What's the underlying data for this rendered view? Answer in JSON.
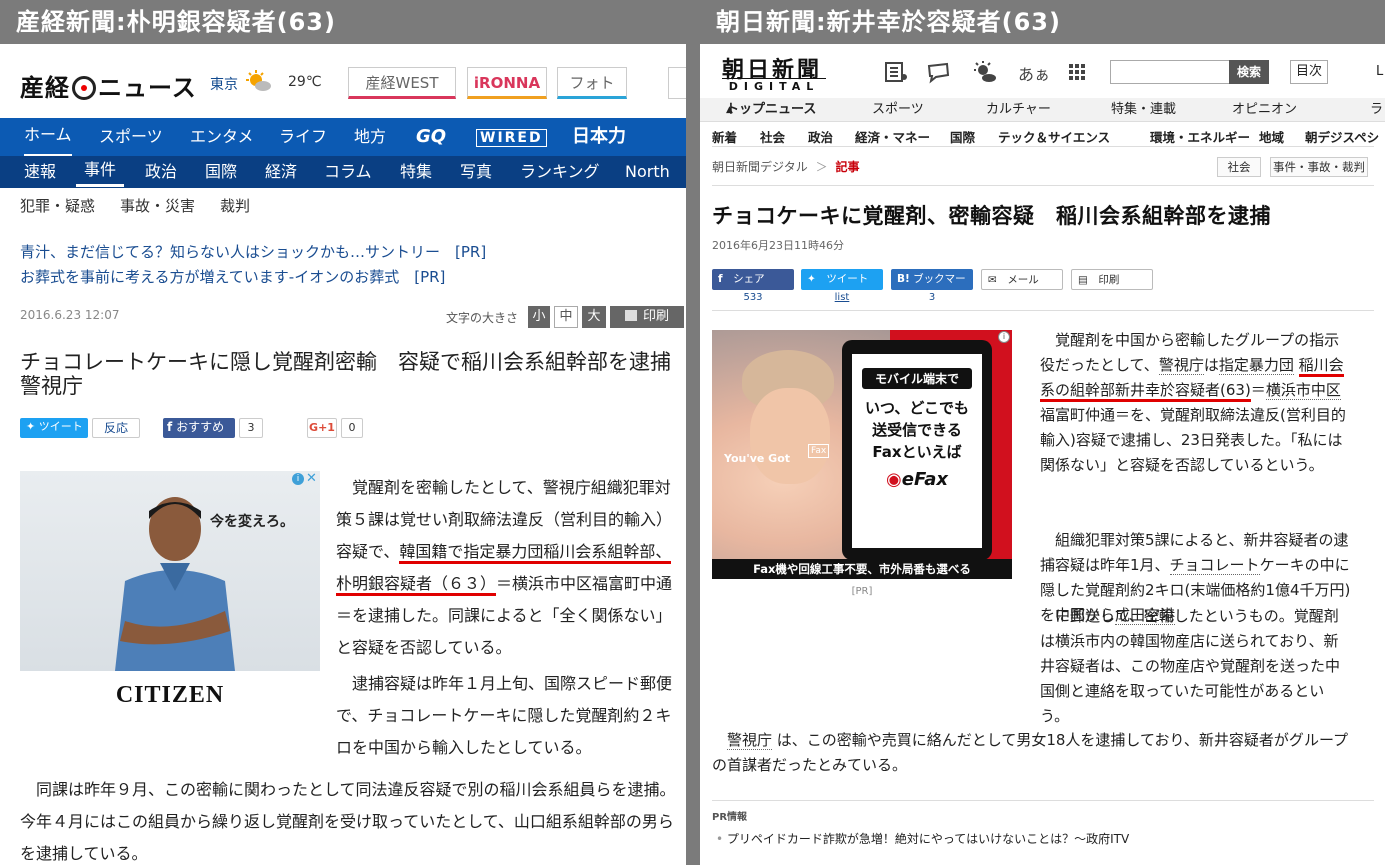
{
  "left": {
    "banner": "産経新聞:朴明銀容疑者(63)",
    "logo": {
      "part1": "産経",
      "part2": "ニュース"
    },
    "weather": {
      "city": "東京",
      "temp": "29℃"
    },
    "tabs": [
      "産経WEST",
      "iRONNA",
      "フォト"
    ],
    "nav_main": [
      "ホーム",
      "スポーツ",
      "エンタメ",
      "ライフ",
      "地方",
      "GQ",
      "WIRED",
      "日本力"
    ],
    "nav_sub": [
      "速報",
      "事件",
      "政治",
      "国際",
      "経済",
      "コラム",
      "特集",
      "写真",
      "ランキング",
      "North Ko"
    ],
    "nav_tertiary": [
      "犯罪・疑惑",
      "事故・災害",
      "裁判"
    ],
    "pr_links": [
      "青汁、まだ信じてる？知らない人はショックかも…サントリー　[PR]",
      "お葬式を事前に考える方が増えています-イオンのお葬式　[PR]"
    ],
    "date": "2016.6.23 12:07",
    "font_size_label": "文字の大きさ",
    "font_sizes": [
      "小",
      "中",
      "大"
    ],
    "print_label": "印刷",
    "title": "チョコレートケーキに隠し覚醒剤密輸　容疑で稲川会系組幹部を逮捕　警視庁",
    "share": {
      "tweet": "ツイート",
      "tweet_count": "反応",
      "fb": "おすすめ",
      "fb_count": "3",
      "gplus": "G+1",
      "gplus_count": "0"
    },
    "ad": {
      "copy": "今を変えろ。",
      "brand": "CITIZEN"
    },
    "body": {
      "p1_a": "覚醒剤を密輸したとして、警視庁組織犯罪対策５課は覚せい剤取締法違反（営利目的輸入）容疑で、",
      "p1_highlight": "韓国籍で指定暴力団稲川会系組幹部、朴明銀容疑者（６３）",
      "p1_b": "＝横浜市中区福富町中通＝を逮捕した。同課によると「全く関係ない」と容疑を否認している。",
      "p2": "逮捕容疑は昨年１月上旬、国際スピード郵便で、チョコレートケーキに隠した覚醒剤約２キロを中国から輸入したとしている。",
      "p3": "同課は昨年９月、この密輸に関わったとして同法違反容疑で別の稲川会系組員らを逮捕。今年４月にはこの組員から繰り返し覚醒剤を受け取っていたとして、山口組系組幹部の男らを逮捕している。"
    }
  },
  "right": {
    "banner": "朝日新聞:新井幸於容疑者(63)",
    "logo": {
      "main": "朝日新聞",
      "sub": "DIGITAL"
    },
    "font_toggle": "あぁ",
    "search_btn": "検索",
    "index_btn": "目次",
    "edge_text": "L",
    "nav_main": [
      "トップニュース",
      "スポーツ",
      "カルチャー",
      "特集・連載",
      "オピニオン",
      "ラ"
    ],
    "nav_sub": [
      "新着",
      "社会",
      "政治",
      "経済・マネー",
      "国際",
      "テック＆サイエンス",
      "環境・エネルギー",
      "地域",
      "朝デジスペシ"
    ],
    "breadcrumb": {
      "home": "朝日新聞デジタル",
      "sep": "＞",
      "current": "記事"
    },
    "tags": [
      "社会",
      "事件・事故・裁判"
    ],
    "title": "チョコケーキに覚醒剤、密輸容疑　稲川会系組幹部を逮捕",
    "date": "2016年6月23日11時46分",
    "share": [
      {
        "label": "シェア",
        "count": "533"
      },
      {
        "label": "ツイート",
        "count": "list"
      },
      {
        "label": "ブックマーク",
        "count": "3"
      },
      {
        "label": "メール",
        "count": ""
      },
      {
        "label": "印刷",
        "count": ""
      }
    ],
    "ad": {
      "line1": "モバイル端末で",
      "line2": "いつ、どこでも",
      "line3": "送受信できる",
      "line4": "Faxといえば",
      "brand": "eFax",
      "got": "You've Got",
      "fax_tag": "Fax",
      "footer": "Fax機や回線工事不要、市外局番も選べる",
      "pr": "[PR]"
    },
    "body": {
      "p1_a": "覚醒剤を中国から密輸したグループの指示役だったとして、",
      "p1_link1": "警視庁",
      "p1_b": "は",
      "p1_link2": "指定暴力団",
      "p1_hl1": "稲川会",
      "p1_hl2": "系の組幹部新井幸於容疑者(63)",
      "p1_c": "＝",
      "p1_link3": "横浜市中区",
      "p1_d": "福富町仲通＝を、覚醒剤取締法違反(営利目的輸入)容疑で逮捕し、23日発表した。「私には関係ない」と容疑を否認しているという。",
      "p2_a": "組織犯罪対策5課によると、新井容疑者の逮捕容疑は昨年1月、",
      "p2_link1": "チョコレート",
      "p2_b": "ケーキの中に隠した覚醒剤約2キロ(末端価格約1億4千万円)を中国から",
      "p2_link2": "成田空港",
      "p2_c": "に郵送して、密輸したというもの。覚醒剤は横浜市内の韓国物産店に送られており、新井容疑者は、この物産店や覚醒剤を送った中国側と連絡を取っていた可能性があるという。",
      "p3_link": "警視庁",
      "p3": "は、この密輸や売買に絡んだとして男女18人を逮捕しており、新井容疑者がグループの首謀者だったとみている。"
    },
    "pr_head": "PR情報",
    "pr_item": "プリペイドカード詐欺が急増！絶対にやってはいけないことは？～政府ITV"
  },
  "colors": {
    "sankei_nav": "#0c5ab3",
    "sankei_nav2": "#0a3f83",
    "asahi_red": "#c8000a",
    "highlight_underline": "#e00000"
  }
}
